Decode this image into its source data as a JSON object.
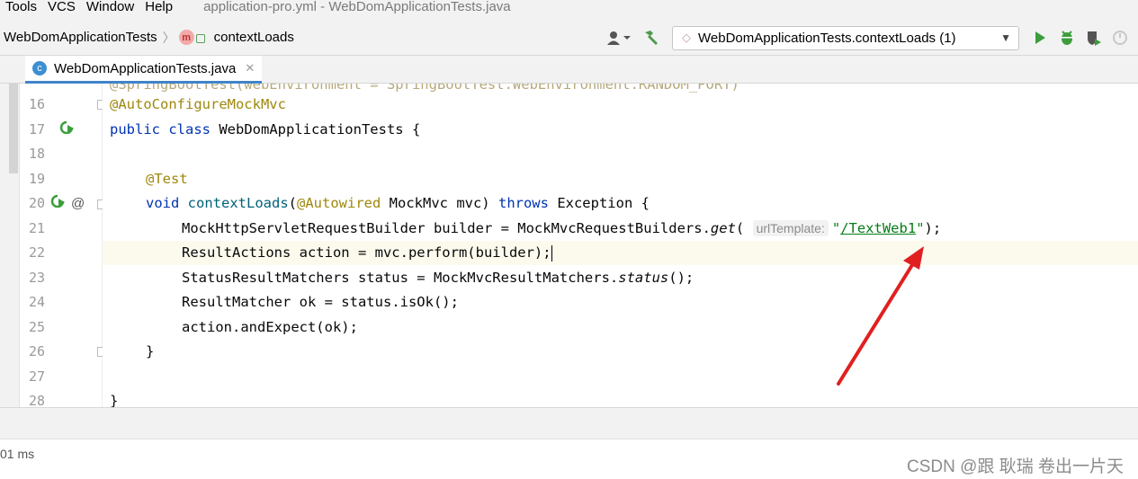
{
  "menubar": {
    "items": [
      "Tools",
      "VCS",
      "Window",
      "Help"
    ],
    "title": "application-pro.yml - WebDomApplicationTests.java"
  },
  "navbar": {
    "breadcrumb_class": "WebDomApplicationTests",
    "breadcrumb_method": "contextLoads",
    "run_config": "WebDomApplicationTests.contextLoads (1)"
  },
  "tab": {
    "label": "WebDomApplicationTests.java"
  },
  "editor": {
    "lines": [
      {
        "num": "16",
        "text": "@AutoConfigureMockMvc"
      },
      {
        "num": "17",
        "text": "public class WebDomApplicationTests {"
      },
      {
        "num": "18",
        "text": ""
      },
      {
        "num": "19",
        "text": "@Test"
      },
      {
        "num": "20",
        "text": "void contextLoads(@Autowired MockMvc mvc) throws Exception {"
      },
      {
        "num": "21",
        "text": "MockHttpServletRequestBuilder builder = MockMvcRequestBuilders.get( urlTemplate: \"/TextWeb1\");"
      },
      {
        "num": "22",
        "text": "ResultActions action = mvc.perform(builder);"
      },
      {
        "num": "23",
        "text": "StatusResultMatchers status = MockMvcResultMatchers.status();"
      },
      {
        "num": "24",
        "text": "ResultMatcher ok = status.isOk();"
      },
      {
        "num": "25",
        "text": "action.andExpect(ok);"
      },
      {
        "num": "26",
        "text": "}"
      },
      {
        "num": "27",
        "text": ""
      },
      {
        "num": "28",
        "text": "}"
      }
    ],
    "partial_line_top": "@SpringBootTest(webEnvironment = SpringBootTest.WebEnvironment.RANDOM_PORT)",
    "param_hint": "urlTemplate:",
    "url_value": "/TextWeb1"
  },
  "status": {
    "left_text": "01 ms",
    "watermark": "CSDN @跟 耿瑞 卷出一片天"
  },
  "colors": {
    "keyword": "#0033b3",
    "annotation": "#9e880d",
    "string": "#067d17",
    "arrow": "#e02020"
  }
}
